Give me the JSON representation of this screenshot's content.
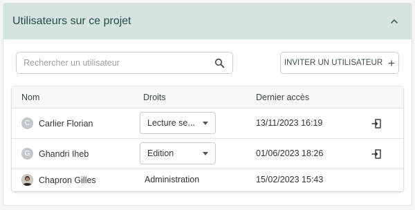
{
  "panel": {
    "title": "Utilisateurs sur ce projet",
    "collapse_icon": "chevron-up-icon"
  },
  "search": {
    "placeholder": "Rechercher un utilisateur",
    "value": "",
    "icon": "search-icon"
  },
  "invite_button": {
    "label": "INVITER UN UTILISATEUR",
    "icon": "plus-icon"
  },
  "table": {
    "headers": [
      "Nom",
      "Droits",
      "Dernier accès"
    ],
    "rows": [
      {
        "initial": "C",
        "name": "Carlier Florian",
        "rights": "Lecture se...",
        "editable": true,
        "last_access": "13/11/2023 16:19",
        "action_icon": "logout-icon"
      },
      {
        "initial": "G",
        "name": "Ghandri Iheb",
        "rights": "Edition",
        "editable": true,
        "last_access": "01/06/2023 18:26",
        "action_icon": "logout-icon"
      },
      {
        "initial": "",
        "name": "Chapron Gilles",
        "rights": "Administration",
        "editable": false,
        "last_access": "15/02/2023 15:43",
        "action_icon": ""
      }
    ]
  },
  "colors": {
    "header_bg": "#d6e4df",
    "header_text": "#274a46",
    "border": "#c9cfcf"
  }
}
